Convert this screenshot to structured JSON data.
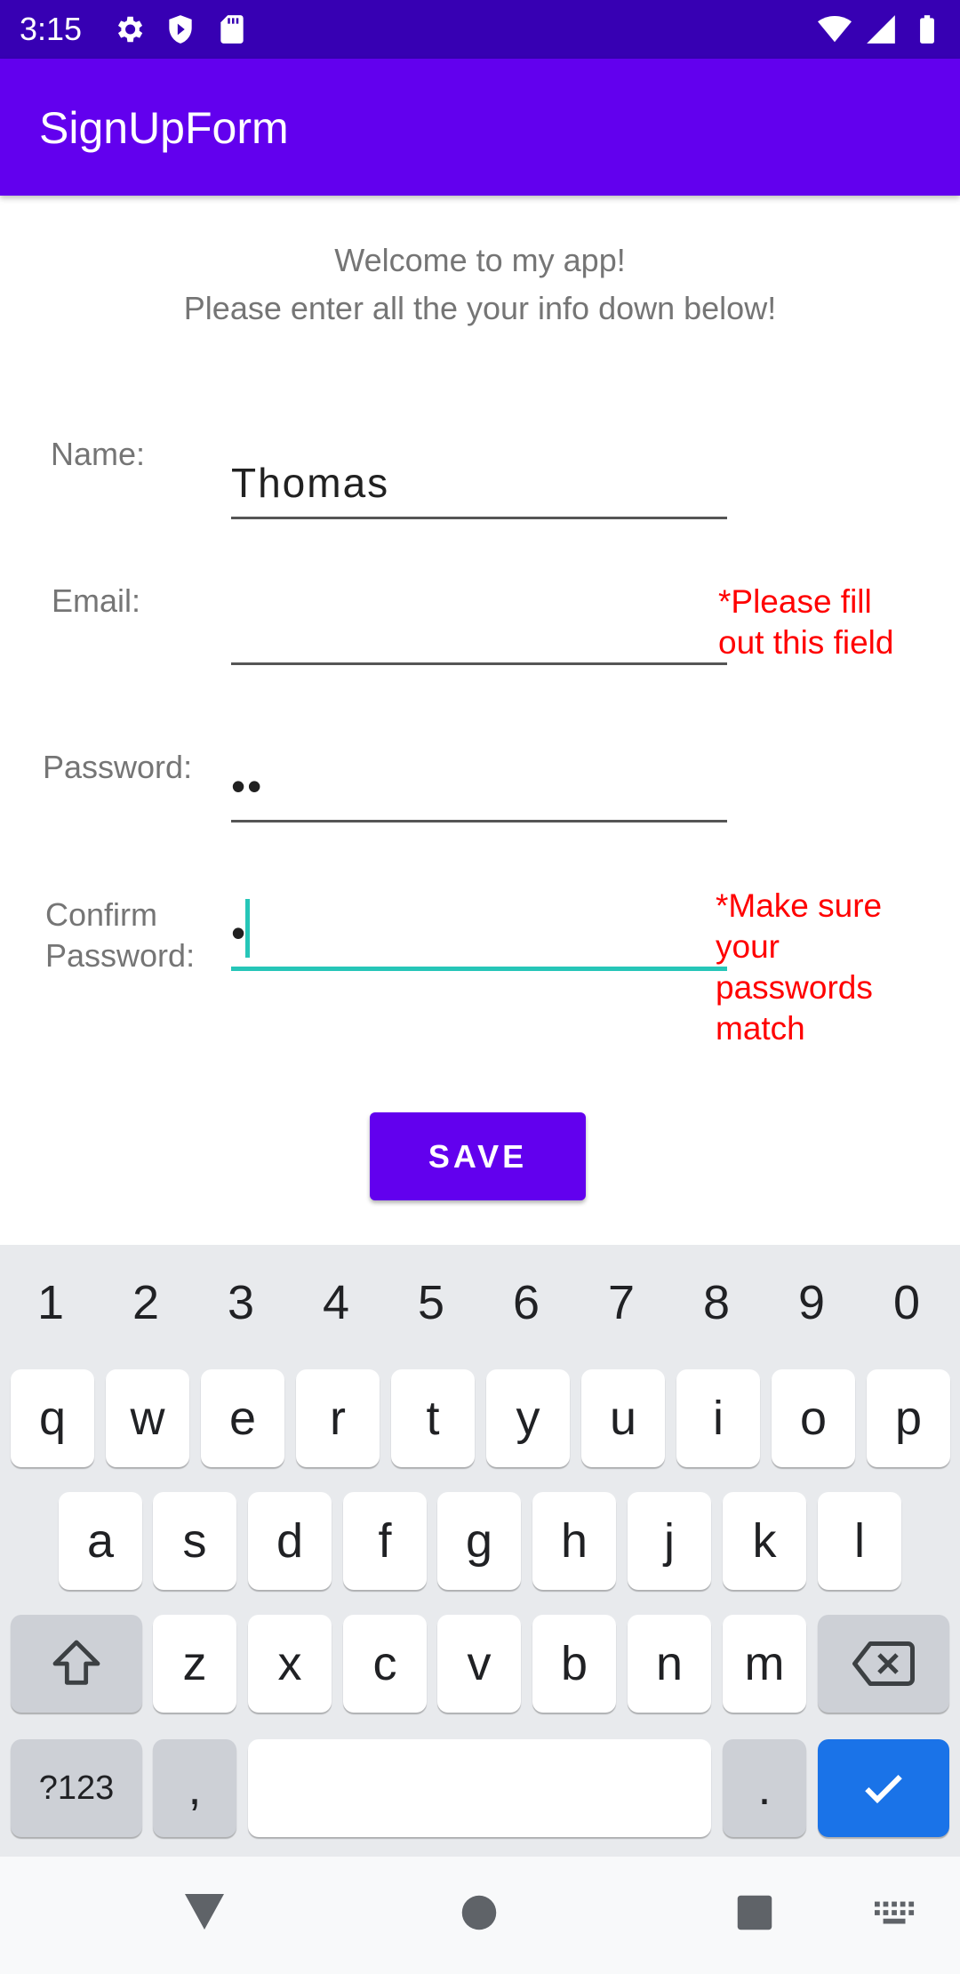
{
  "status_bar": {
    "time": "3:15",
    "left_icons": [
      "settings-icon",
      "shield-icon",
      "sd-card-icon"
    ],
    "right_icons": [
      "wifi-icon",
      "signal-icon",
      "battery-icon"
    ]
  },
  "app_bar": {
    "title": "SignUpForm"
  },
  "welcome": {
    "line1": "Welcome to my app!",
    "line2": "Please enter all the your info down below!"
  },
  "form": {
    "name": {
      "label": "Name:",
      "value": "Thomas"
    },
    "email": {
      "label": "Email:",
      "value": "",
      "error": "*Please fill out this field"
    },
    "password": {
      "label": "Password:",
      "value": "••"
    },
    "confirm": {
      "label_line1": "Confirm",
      "label_line2": "Password:",
      "value": "•",
      "error": "*Make sure your passwords match"
    },
    "save_label": "SAVE"
  },
  "keyboard": {
    "numbers": [
      "1",
      "2",
      "3",
      "4",
      "5",
      "6",
      "7",
      "8",
      "9",
      "0"
    ],
    "row1": [
      "q",
      "w",
      "e",
      "r",
      "t",
      "y",
      "u",
      "i",
      "o",
      "p"
    ],
    "row2": [
      "a",
      "s",
      "d",
      "f",
      "g",
      "h",
      "j",
      "k",
      "l"
    ],
    "row3": [
      "z",
      "x",
      "c",
      "v",
      "b",
      "n",
      "m"
    ],
    "symbols_label": "?123",
    "comma_label": ",",
    "period_label": ".",
    "shift_icon": "shift-icon",
    "backspace_icon": "backspace-icon",
    "enter_icon": "checkmark-icon"
  },
  "nav_bar": {
    "icons": [
      "back-icon",
      "home-icon",
      "recents-icon",
      "keyboard-switch-icon"
    ]
  },
  "colors": {
    "status_bar": "#3700b3",
    "app_bar": "#6200ee",
    "error": "#ff0000",
    "focus_underline": "#26c6b8",
    "enter_key": "#1a73e8"
  }
}
